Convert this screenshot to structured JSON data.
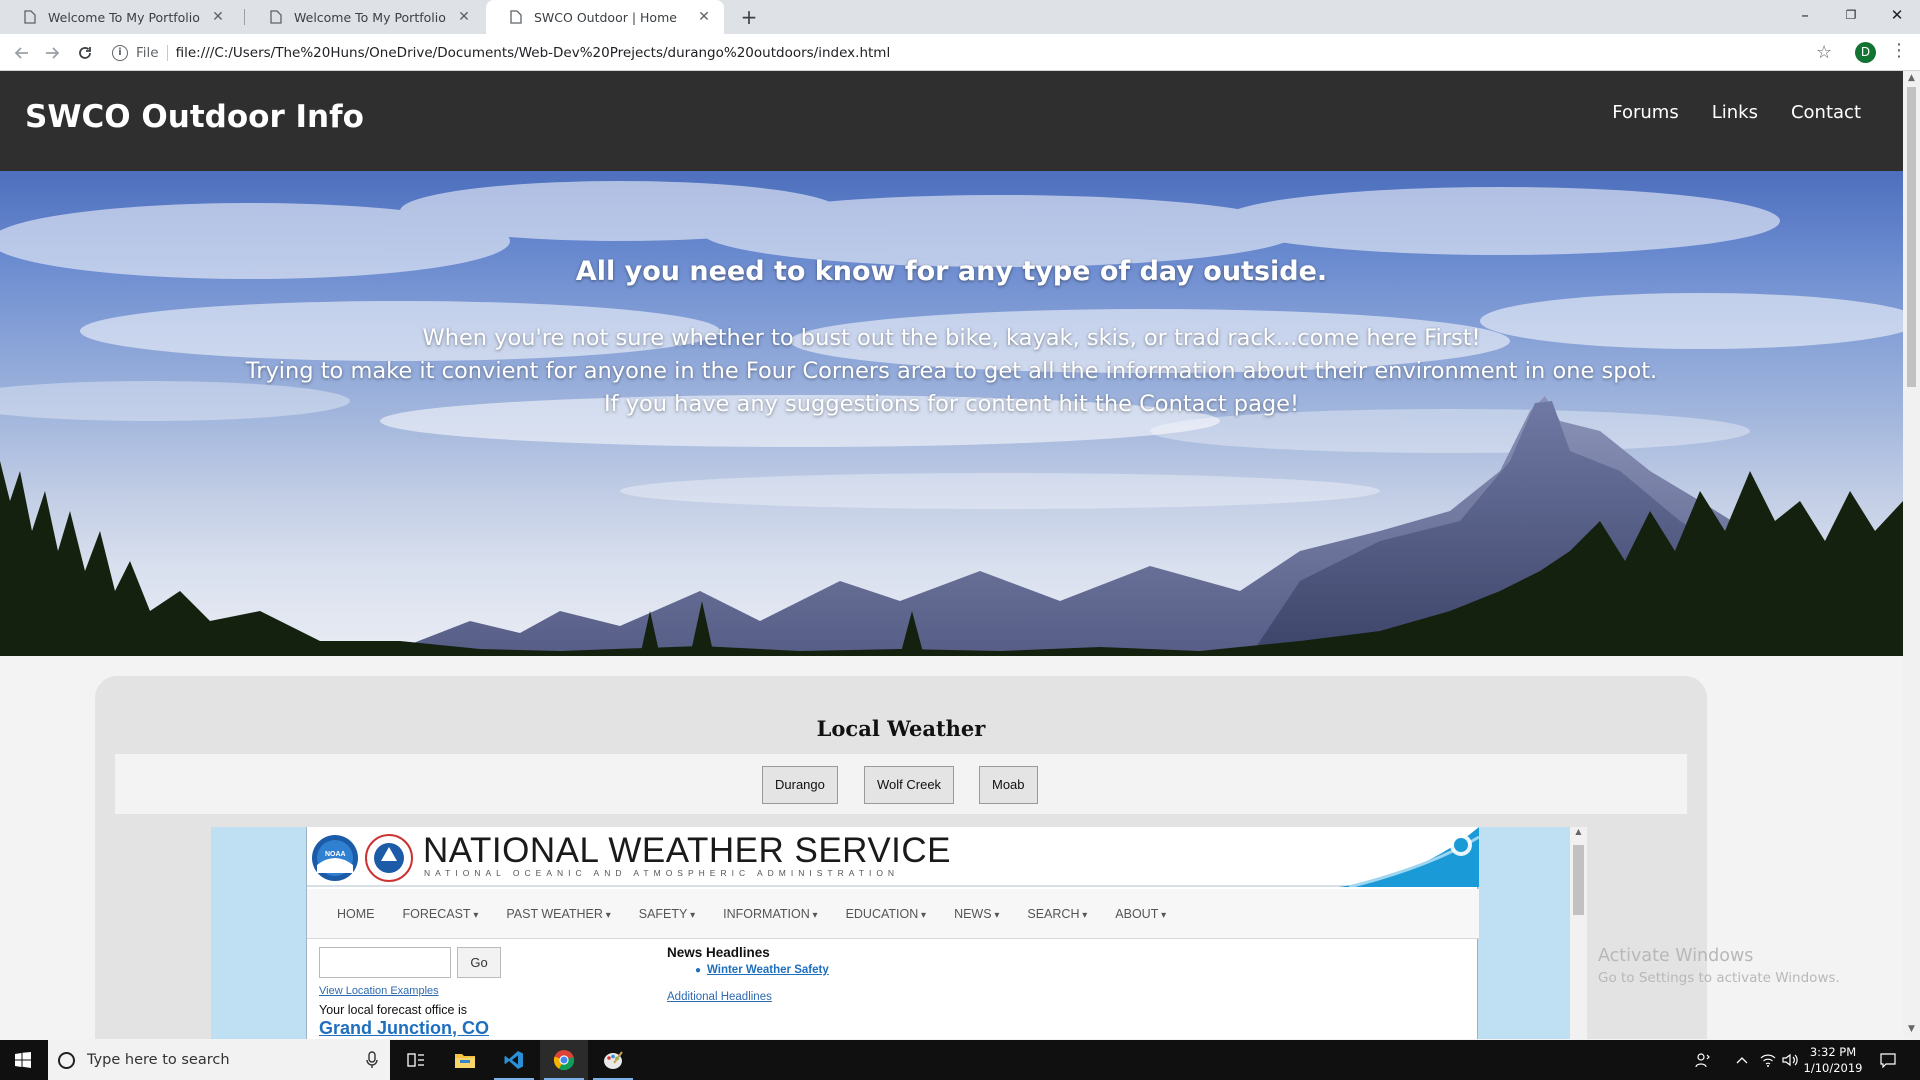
{
  "browser": {
    "tabs": [
      {
        "label": "Welcome To My Portfolio"
      },
      {
        "label": "Welcome To My Portfolio"
      },
      {
        "label": "SWCO Outdoor | Home"
      }
    ],
    "new_tab": "+",
    "url_scheme": "File",
    "url": "file:///C:/Users/The%20Huns/OneDrive/Documents/Web-Dev%20Prejects/durango%20outdoors/index.html",
    "profile_initial": "D",
    "window_controls": {
      "minimize": "–",
      "restore": "❐",
      "close": "✕"
    }
  },
  "site": {
    "brand": "SWCO Outdoor Info",
    "nav": [
      "Forums",
      "Links",
      "Contact"
    ]
  },
  "hero": {
    "title": "All you need to know for any type of day outside.",
    "lines": [
      "When you're not sure whether to bust out the bike, kayak, skis, or trad rack...come here First!",
      "Trying to make it convient for anyone in the Four Corners area to get all the information about their environment in one spot.",
      "If you have any suggestions for content hit the Contact page!"
    ]
  },
  "weather": {
    "title": "Local Weather",
    "locations": [
      "Durango",
      "Wolf Creek",
      "Moab"
    ]
  },
  "nws": {
    "title": "NATIONAL WEATHER SERVICE",
    "subtitle": "NATIONAL OCEANIC AND ATMOSPHERIC ADMINISTRATION",
    "menu": [
      "HOME",
      "FORECAST",
      "PAST WEATHER",
      "SAFETY",
      "INFORMATION",
      "EDUCATION",
      "NEWS",
      "SEARCH",
      "ABOUT"
    ],
    "go_label": "Go",
    "location_examples": "View Location Examples",
    "office_label": "Your local forecast office is",
    "office_name": "Grand Junction, CO",
    "news_heading": "News Headlines",
    "news_item": "Winter Weather Safety",
    "additional": "Additional Headlines"
  },
  "watermark": {
    "line1": "Activate Windows",
    "line2": "Go to Settings to activate Windows."
  },
  "taskbar": {
    "search_placeholder": "Type here to search",
    "time": "3:32 PM",
    "date": "1/10/2019"
  }
}
